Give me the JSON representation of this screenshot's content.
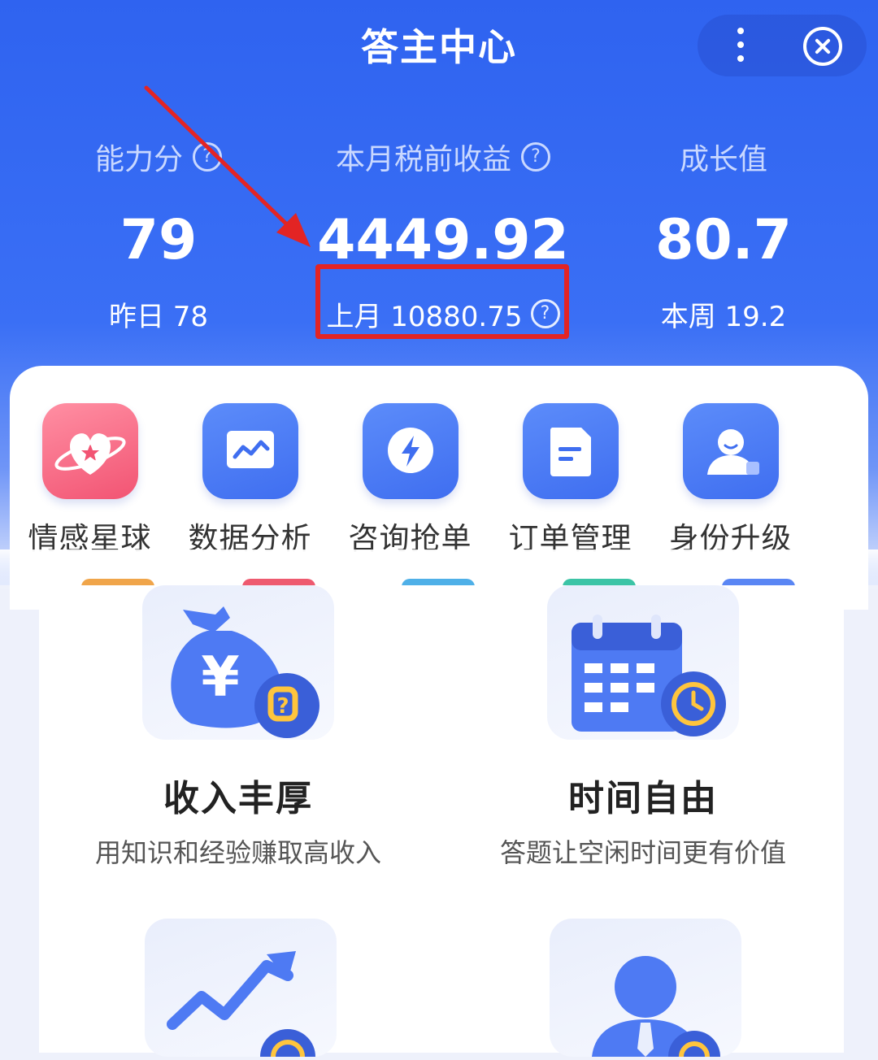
{
  "header": {
    "title": "答主中心"
  },
  "stats": [
    {
      "label": "能力分",
      "value": "79",
      "sub": "昨日 78",
      "has_help": true
    },
    {
      "label": "本月税前收益",
      "value": "4449.92",
      "sub": "上月 10880.75",
      "has_help": true
    },
    {
      "label": "成长值",
      "value": "80.7",
      "sub": "本周 19.2",
      "has_help": false
    }
  ],
  "help_glyph": "?",
  "menu": [
    {
      "label": "情感星球",
      "icon": "heart-planet-icon"
    },
    {
      "label": "数据分析",
      "icon": "line-chart-icon"
    },
    {
      "label": "咨询抢单",
      "icon": "lightning-icon"
    },
    {
      "label": "订单管理",
      "icon": "document-icon"
    },
    {
      "label": "身份升级",
      "icon": "user-upgrade-icon"
    }
  ],
  "features": [
    {
      "title": "收入丰厚",
      "desc": "用知识和经验赚取高收入",
      "icon": "money-bag-icon"
    },
    {
      "title": "时间自由",
      "desc": "答题让空闲时间更有价值",
      "icon": "calendar-clock-icon"
    }
  ],
  "colors": {
    "header_blue": "#2f63f0",
    "highlight_red": "#e32424",
    "icon_blue": "#4a78f2",
    "icon_pink": "#f25473"
  }
}
